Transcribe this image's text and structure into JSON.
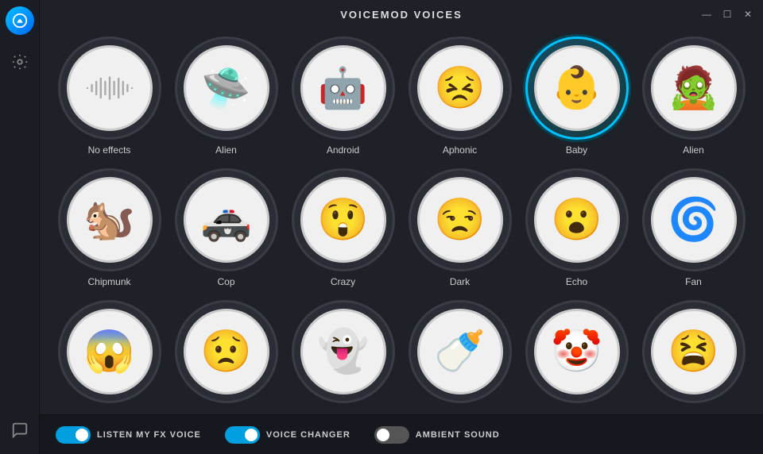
{
  "app": {
    "title": "VOICEMOD VOICES",
    "window_controls": [
      "—",
      "☐",
      "✕"
    ]
  },
  "sidebar": {
    "logo_alt": "voicemod-logo",
    "settings_label": "Settings",
    "chat_label": "Chat"
  },
  "voices": [
    {
      "id": "no-effects",
      "label": "No effects",
      "emoji": "waveform",
      "active": false,
      "teal": false
    },
    {
      "id": "alien",
      "label": "Alien",
      "emoji": "🛸",
      "active": false,
      "teal": false
    },
    {
      "id": "android",
      "label": "Android",
      "emoji": "🤖",
      "active": false,
      "teal": false
    },
    {
      "id": "aphonic",
      "label": "Aphonic",
      "emoji": "😣",
      "active": false,
      "teal": false
    },
    {
      "id": "baby",
      "label": "Baby",
      "emoji": "👶",
      "active": false,
      "teal": true
    },
    {
      "id": "alien2",
      "label": "Alien",
      "emoji": "🧟",
      "active": false,
      "teal": false
    },
    {
      "id": "chipmunk",
      "label": "Chipmunk",
      "emoji": "🐿️",
      "active": false,
      "teal": false
    },
    {
      "id": "cop",
      "label": "Cop",
      "emoji": "🚓",
      "active": false,
      "teal": false
    },
    {
      "id": "crazy",
      "label": "Crazy",
      "emoji": "😲",
      "active": false,
      "teal": false
    },
    {
      "id": "dark",
      "label": "Dark",
      "emoji": "😒",
      "active": false,
      "teal": false
    },
    {
      "id": "echo",
      "label": "Echo",
      "emoji": "😮",
      "active": false,
      "teal": false
    },
    {
      "id": "fan",
      "label": "Fan",
      "emoji": "🌀",
      "active": false,
      "teal": false
    },
    {
      "id": "partial1",
      "label": "",
      "emoji": "😱",
      "active": false,
      "teal": false,
      "partial": true
    },
    {
      "id": "partial2",
      "label": "",
      "emoji": "😟",
      "active": false,
      "teal": false,
      "partial": true
    },
    {
      "id": "partial3",
      "label": "",
      "emoji": "👻",
      "active": false,
      "teal": false,
      "partial": true
    },
    {
      "id": "partial4",
      "label": "",
      "emoji": "🍼",
      "active": false,
      "teal": false,
      "partial": true
    },
    {
      "id": "partial5",
      "label": "",
      "emoji": "🤡",
      "active": false,
      "teal": false,
      "partial": true
    },
    {
      "id": "partial6",
      "label": "",
      "emoji": "😫",
      "active": false,
      "teal": false,
      "partial": true
    }
  ],
  "bottom_bar": {
    "toggles": [
      {
        "id": "listen-fx",
        "label": "LISTEN MY FX VOICE",
        "on": true
      },
      {
        "id": "voice-changer",
        "label": "VOICE CHANGER",
        "on": true
      },
      {
        "id": "ambient-sound",
        "label": "AMBIENT SOUND",
        "on": false
      }
    ]
  }
}
